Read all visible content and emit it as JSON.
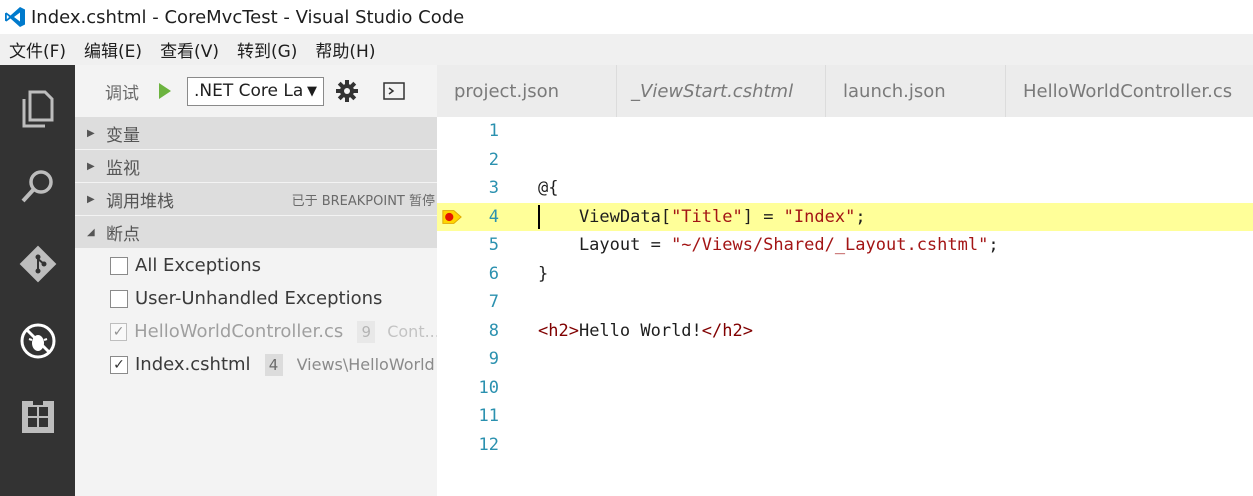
{
  "window": {
    "title": "Index.cshtml - CoreMvcTest - Visual Studio Code",
    "accent_color": "#007acc"
  },
  "menu": [
    "文件(F)",
    "编辑(E)",
    "查看(V)",
    "转到(G)",
    "帮助(H)"
  ],
  "activity_bar": {
    "icons": [
      "explorer-icon",
      "search-icon",
      "git-icon",
      "debug-icon",
      "extensions-icon"
    ],
    "active": "debug-icon"
  },
  "debug": {
    "label": "调试",
    "configuration": ".NET Core La",
    "play_icon_color": "#6cb33f"
  },
  "sections": {
    "variables": "变量",
    "watch": "监视",
    "call_stack": "调用堆栈",
    "call_stack_status": "已于 BREAKPOINT 暂停",
    "breakpoints": "断点"
  },
  "breakpoints": [
    {
      "label": "All Exceptions",
      "checked": false,
      "line": "",
      "path": ""
    },
    {
      "label": "User-Unhandled Exceptions",
      "checked": false,
      "line": "",
      "path": ""
    },
    {
      "label": "HelloWorldController.cs",
      "checked": true,
      "line": "9",
      "path": "Cont..."
    },
    {
      "label": "Index.cshtml",
      "checked": true,
      "line": "4",
      "path": "Views\\HelloWorld"
    }
  ],
  "tabs": [
    {
      "label": "project.json",
      "italic": false
    },
    {
      "label": "_ViewStart.cshtml",
      "italic": true
    },
    {
      "label": "launch.json",
      "italic": false
    },
    {
      "label": "HelloWorldController.cs",
      "italic": false
    }
  ],
  "editor": {
    "current_line": 4,
    "breakpoint_line": 4,
    "line_numbers": [
      "1",
      "2",
      "3",
      "4",
      "5",
      "6",
      "7",
      "8",
      "9",
      "10",
      "11",
      "12"
    ],
    "lines": {
      "l3": "@{",
      "l4_a": "    ViewData[",
      "l4_b": "\"Title\"",
      "l4_c": "] = ",
      "l4_d": "\"Index\"",
      "l4_e": ";",
      "l5_a": "    Layout = ",
      "l5_b": "\"~/Views/Shared/_Layout.cshtml\"",
      "l5_c": ";",
      "l6": "}",
      "l8_a": "<h2>",
      "l8_b": "Hello World!",
      "l8_c": "</h2>"
    }
  }
}
